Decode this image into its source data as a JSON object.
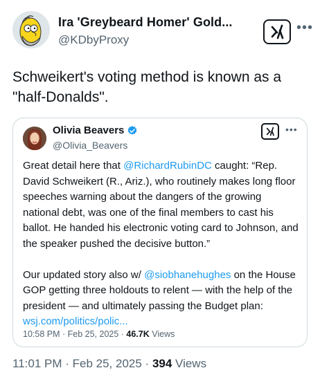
{
  "author": {
    "display_name": "Ira 'Greybeard Homer' Gold...",
    "handle": "@KDbyProxy",
    "avatar_icon": "homer-simpson-avatar-icon"
  },
  "tweet": {
    "text": "Schweikert's voting method is known as a \"half-Donalds\"."
  },
  "quoted": {
    "display_name": "Olivia Beavers",
    "handle": "@Olivia_Beavers",
    "verified_icon": "verified-badge-icon",
    "para1_prefix": "Great detail here that ",
    "para1_mention": "@RichardRubinDC",
    "para1_rest": " caught: “Rep. David Schweikert (R., Ariz.), who routinely makes long floor speeches warning about the dangers of the growing national debt, was one of the final members to cast his ballot. He handed his electronic voting card to Johnson, and the speaker pushed the decisive button.”",
    "para2_prefix": "Our updated story also w/ ",
    "para2_mention": "@siobhanehughes",
    "para2_rest": " on the House GOP getting three holdouts to relent — with the help of the president — and ultimately passing the Budget plan: ",
    "link": "wsj.com/politics/polic...",
    "time": "10:58 PM",
    "date": "Feb 25, 2025",
    "views_count": "46.7K",
    "views_label": "Views"
  },
  "meta": {
    "time": "11:01 PM",
    "date": "Feb 25, 2025",
    "views_count": "394",
    "views_label": "Views"
  },
  "colors": {
    "link": "#1d9bf0",
    "secondary_text": "#536471",
    "border": "#cfd9de",
    "verified": "#1d9bf0"
  }
}
